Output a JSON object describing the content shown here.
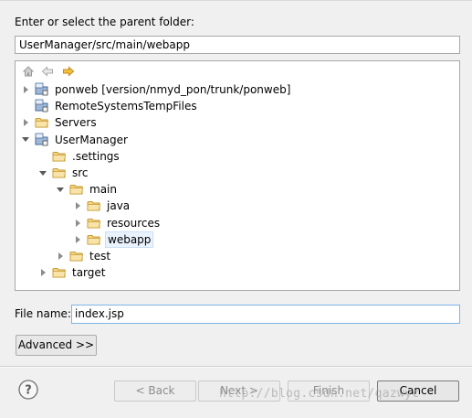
{
  "colors": {
    "background": "#f0f0f0",
    "folder": "#e8c26b",
    "nav_forward": "#e0a020",
    "selection": "#eaf3fd"
  },
  "parent_folder": {
    "label": "Enter or select the parent folder:",
    "value": "UserManager/src/main/webapp"
  },
  "tree": {
    "nav_icons": [
      "home-icon",
      "back-arrow-icon",
      "forward-arrow-icon"
    ],
    "items": [
      {
        "label": "ponweb [version/nmyd_pon/trunk/ponweb]",
        "icon": "project-icon",
        "depth": 0,
        "twisty": "closed"
      },
      {
        "label": "RemoteSystemsTempFiles",
        "icon": "project-icon",
        "depth": 0,
        "twisty": "none"
      },
      {
        "label": "Servers",
        "icon": "folder-icon",
        "depth": 0,
        "twisty": "closed"
      },
      {
        "label": "UserManager",
        "icon": "project-icon",
        "depth": 0,
        "twisty": "open"
      },
      {
        "label": ".settings",
        "icon": "folder-icon",
        "depth": 1,
        "twisty": "none"
      },
      {
        "label": "src",
        "icon": "folder-icon",
        "depth": 1,
        "twisty": "open"
      },
      {
        "label": "main",
        "icon": "folder-icon",
        "depth": 2,
        "twisty": "open"
      },
      {
        "label": "java",
        "icon": "folder-icon",
        "depth": 3,
        "twisty": "closed"
      },
      {
        "label": "resources",
        "icon": "folder-icon",
        "depth": 3,
        "twisty": "closed"
      },
      {
        "label": "webapp",
        "icon": "folder-icon",
        "depth": 3,
        "twisty": "closed",
        "selected": true
      },
      {
        "label": "test",
        "icon": "folder-icon",
        "depth": 2,
        "twisty": "closed"
      },
      {
        "label": "target",
        "icon": "folder-icon",
        "depth": 1,
        "twisty": "closed"
      }
    ]
  },
  "file_name": {
    "label": "File name:",
    "value": "index.jsp"
  },
  "advanced_button": "Advanced >>",
  "footer": {
    "help_icon": "help-icon",
    "back": "< Back",
    "next": "Next >",
    "finish": "Finish",
    "cancel": "Cancel"
  },
  "watermark": "http://blog.csdn.net/qazwyc"
}
